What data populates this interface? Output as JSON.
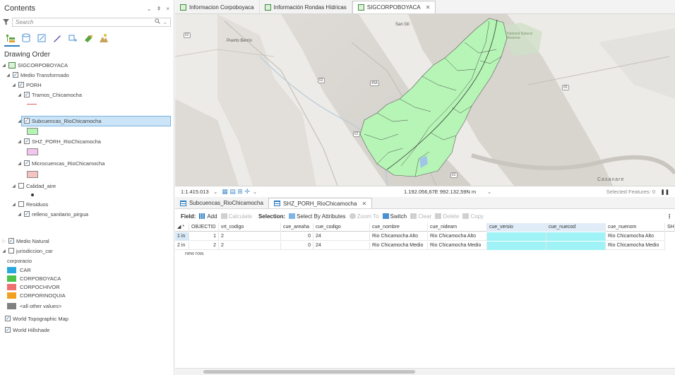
{
  "contents": {
    "title": "Contents",
    "header_controls": [
      "⌄",
      "⇞",
      "×"
    ],
    "search_placeholder": "Search",
    "drawing_order_label": "Drawing Order",
    "tree": {
      "map": "SIGCORPOBOYACA",
      "medio_transformado": "Medio Transformado",
      "porh": "PORH",
      "tramos": "Tramos_Chicamocha",
      "subcuencas": "Subcuencas_RioChicamocha",
      "shz": "SHZ_PORH_RioChicamocha",
      "microcuencas": "Microcuencas_RioChicamocha",
      "calidad_aire": "Calidad_aire",
      "residuos": "Residuos",
      "relleno": "relleno_sanitario_pirgua",
      "medio_natural": "Medio Natural",
      "jurisdiccion": "jurisdiccion_car",
      "field": "corporacio",
      "legend": [
        {
          "label": "CAR",
          "color": "#29a8e0"
        },
        {
          "label": "CORPOBOYACA",
          "color": "#4cc44c"
        },
        {
          "label": "CORPOCHIVOR",
          "color": "#f07070"
        },
        {
          "label": "CORPORINOQUIA",
          "color": "#f2a020"
        },
        {
          "label": "<all other values>",
          "color": "#808080"
        }
      ],
      "topo": "World Topographic Map",
      "hillshade": "World Hillshade"
    },
    "swatch_colors": {
      "subcuencas": "#b4f5b4",
      "shz": "#f5c6ec",
      "microcuencas": "#f6c3c3",
      "tramos_line": "#e06060"
    }
  },
  "map_tabs": [
    {
      "label": "Informacion Corpoboyaca",
      "active": false
    },
    {
      "label": "Información Rondas Hídricas",
      "active": false
    },
    {
      "label": "SIGCORPOBOYACA",
      "active": true
    }
  ],
  "map": {
    "labels": {
      "puerto_berrio": "Puerto Berrío",
      "san_gil": "San Gil",
      "casanare": "Casanare",
      "nat_park": "National Natural Reserve"
    },
    "shields": [
      "62",
      "62",
      "45A",
      "62",
      "65",
      "62"
    ],
    "polygon_color": "#b6f5b6"
  },
  "map_status": {
    "scale": "1:1.415.013",
    "coords": "1.192.056,67E 992.132,59N m",
    "selected_features": "Selected Features: 0"
  },
  "table_tabs": [
    {
      "label": "Subcuencas_RioChicamocha",
      "active": false
    },
    {
      "label": "SHZ_PORH_RioChicamocha",
      "active": true
    }
  ],
  "table_toolbar": {
    "field_label": "Field:",
    "add": "Add",
    "calculate": "Calculate",
    "selection_label": "Selection:",
    "select_by_attributes": "Select By Attributes",
    "zoom_to": "Zoom To",
    "switch": "Switch",
    "clear": "Clear",
    "delete": "Delete",
    "copy": "Copy"
  },
  "table": {
    "columns": [
      "OBJECTID",
      "vrt_codigo",
      "cue_areaha",
      "cue_codigo",
      "cue_nombre",
      "cue_nideam",
      "cue_versio",
      "cue_nuecod",
      "cue_nuenom",
      "SH"
    ],
    "rows": [
      {
        "rownum": "1",
        "marker": "in",
        "objectid": "1",
        "vrt_codigo": "2",
        "cue_areaha": "0",
        "cue_codigo": "24",
        "cue_nombre": "Rio Chicamocha Alto",
        "cue_nideam": "Rio Chicamocha Alto",
        "cue_versio": "",
        "cue_nuecod": "",
        "cue_nuenom": "Rio Chicamocha Alto"
      },
      {
        "rownum": "2",
        "marker": "in",
        "objectid": "2",
        "vrt_codigo": "2",
        "cue_areaha": "0",
        "cue_codigo": "24",
        "cue_nombre": "Rio Chicamocha Medio",
        "cue_nideam": "Rio Chicamocha Medio",
        "cue_versio": "",
        "cue_nuecod": "",
        "cue_nuenom": "Rio Chicamocha Medio"
      }
    ],
    "new_row_text": "new row."
  }
}
